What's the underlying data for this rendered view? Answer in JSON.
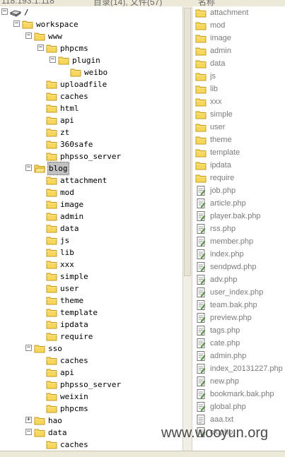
{
  "header": {
    "address": "118.193.1.118",
    "status": "目录(14), 文件(57)",
    "column_name": "名称"
  },
  "tree": [
    {
      "label": "/",
      "depth": 0,
      "expander": "−",
      "icon": "drive"
    },
    {
      "label": "workspace",
      "depth": 1,
      "expander": "−",
      "icon": "folder"
    },
    {
      "label": "www",
      "depth": 2,
      "expander": "−",
      "icon": "folder"
    },
    {
      "label": "phpcms",
      "depth": 3,
      "expander": "−",
      "icon": "folder"
    },
    {
      "label": "plugin",
      "depth": 4,
      "expander": "−",
      "icon": "folder"
    },
    {
      "label": "weibo",
      "depth": 5,
      "expander": "",
      "icon": "folder"
    },
    {
      "label": "uploadfile",
      "depth": 3,
      "expander": "",
      "icon": "folder"
    },
    {
      "label": "caches",
      "depth": 3,
      "expander": "",
      "icon": "folder"
    },
    {
      "label": "html",
      "depth": 3,
      "expander": "",
      "icon": "folder"
    },
    {
      "label": "api",
      "depth": 3,
      "expander": "",
      "icon": "folder"
    },
    {
      "label": "zt",
      "depth": 3,
      "expander": "",
      "icon": "folder"
    },
    {
      "label": "360safe",
      "depth": 3,
      "expander": "",
      "icon": "folder"
    },
    {
      "label": "phpsso_server",
      "depth": 3,
      "expander": "",
      "icon": "folder"
    },
    {
      "label": "blog",
      "depth": 2,
      "expander": "−",
      "icon": "folder-open",
      "selected": true
    },
    {
      "label": "attachment",
      "depth": 3,
      "expander": "",
      "icon": "folder"
    },
    {
      "label": "mod",
      "depth": 3,
      "expander": "",
      "icon": "folder"
    },
    {
      "label": "image",
      "depth": 3,
      "expander": "",
      "icon": "folder"
    },
    {
      "label": "admin",
      "depth": 3,
      "expander": "",
      "icon": "folder"
    },
    {
      "label": "data",
      "depth": 3,
      "expander": "",
      "icon": "folder"
    },
    {
      "label": "js",
      "depth": 3,
      "expander": "",
      "icon": "folder"
    },
    {
      "label": "lib",
      "depth": 3,
      "expander": "",
      "icon": "folder"
    },
    {
      "label": "xxx",
      "depth": 3,
      "expander": "",
      "icon": "folder"
    },
    {
      "label": "simple",
      "depth": 3,
      "expander": "",
      "icon": "folder"
    },
    {
      "label": "user",
      "depth": 3,
      "expander": "",
      "icon": "folder"
    },
    {
      "label": "theme",
      "depth": 3,
      "expander": "",
      "icon": "folder"
    },
    {
      "label": "template",
      "depth": 3,
      "expander": "",
      "icon": "folder"
    },
    {
      "label": "ipdata",
      "depth": 3,
      "expander": "",
      "icon": "folder"
    },
    {
      "label": "require",
      "depth": 3,
      "expander": "",
      "icon": "folder"
    },
    {
      "label": "sso",
      "depth": 2,
      "expander": "−",
      "icon": "folder"
    },
    {
      "label": "caches",
      "depth": 3,
      "expander": "",
      "icon": "folder"
    },
    {
      "label": "api",
      "depth": 3,
      "expander": "",
      "icon": "folder"
    },
    {
      "label": "phpsso_server",
      "depth": 3,
      "expander": "",
      "icon": "folder"
    },
    {
      "label": "weixin",
      "depth": 3,
      "expander": "",
      "icon": "folder"
    },
    {
      "label": "phpcms",
      "depth": 3,
      "expander": "",
      "icon": "folder"
    },
    {
      "label": "hao",
      "depth": 2,
      "expander": "+",
      "icon": "folder"
    },
    {
      "label": "data",
      "depth": 2,
      "expander": "−",
      "icon": "folder"
    },
    {
      "label": "caches",
      "depth": 3,
      "expander": "",
      "icon": "folder"
    }
  ],
  "files": [
    {
      "name": "attachment",
      "type": "folder"
    },
    {
      "name": "mod",
      "type": "folder"
    },
    {
      "name": "image",
      "type": "folder"
    },
    {
      "name": "admin",
      "type": "folder"
    },
    {
      "name": "data",
      "type": "folder"
    },
    {
      "name": "js",
      "type": "folder"
    },
    {
      "name": "lib",
      "type": "folder"
    },
    {
      "name": "xxx",
      "type": "folder"
    },
    {
      "name": "simple",
      "type": "folder"
    },
    {
      "name": "user",
      "type": "folder"
    },
    {
      "name": "theme",
      "type": "folder"
    },
    {
      "name": "template",
      "type": "folder"
    },
    {
      "name": "ipdata",
      "type": "folder"
    },
    {
      "name": "require",
      "type": "folder"
    },
    {
      "name": "job.php",
      "type": "php"
    },
    {
      "name": "article.php",
      "type": "php"
    },
    {
      "name": "player.bak.php",
      "type": "php"
    },
    {
      "name": "rss.php",
      "type": "php"
    },
    {
      "name": "member.php",
      "type": "php"
    },
    {
      "name": "index.php",
      "type": "php"
    },
    {
      "name": "sendpwd.php",
      "type": "php"
    },
    {
      "name": "adv.php",
      "type": "php"
    },
    {
      "name": "user_index.php",
      "type": "php"
    },
    {
      "name": "team.bak.php",
      "type": "php"
    },
    {
      "name": "preview.php",
      "type": "php"
    },
    {
      "name": "tags.php",
      "type": "php"
    },
    {
      "name": "cate.php",
      "type": "php"
    },
    {
      "name": "admin.php",
      "type": "php"
    },
    {
      "name": "index_20131227.php",
      "type": "php"
    },
    {
      "name": "new.php",
      "type": "php"
    },
    {
      "name": "bookmark.bak.php",
      "type": "php"
    },
    {
      "name": "global.php",
      "type": "php"
    },
    {
      "name": "aaa.txt",
      "type": "txt"
    },
    {
      "name": "ck.php",
      "type": "php"
    }
  ],
  "watermark": "www.wooyun.org",
  "colors": {
    "folder": "#f7d65c",
    "folder_border": "#c29a1d",
    "selection": "#c0c0c0",
    "file_text": "#7a7a7a"
  }
}
